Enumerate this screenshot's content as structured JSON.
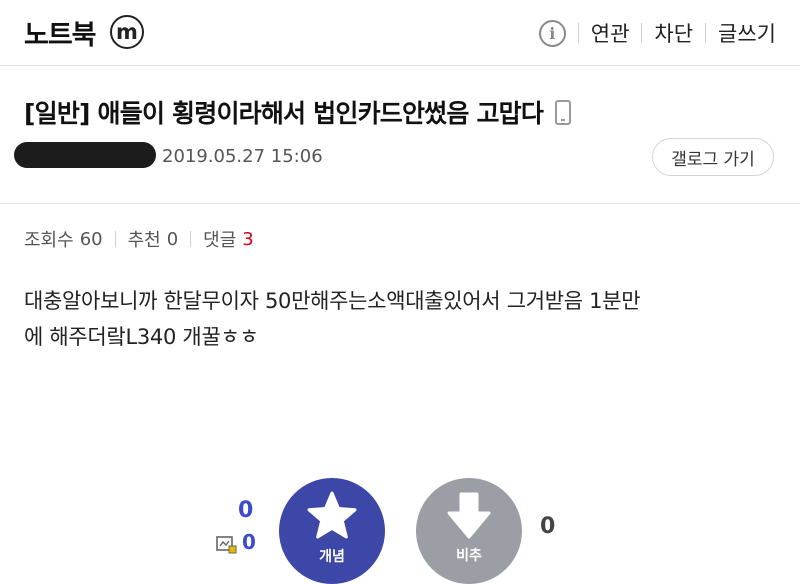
{
  "header": {
    "gallery_name": "노트북",
    "badge": "ⓜ",
    "actions": [
      "연관",
      "차단",
      "글쓰기"
    ]
  },
  "post": {
    "title": "[일반] 애들이 횡령이라해서 법인카드안썼음 고맙다",
    "date": "2019.05.27 15:06",
    "gallog_label": "갤로그 가기",
    "stats": {
      "views_label": "조회수",
      "views": "60",
      "recommend_label": "추천",
      "recommend": "0",
      "comments_label": "댓글",
      "comments": "3"
    },
    "body_lines": [
      "대충알아보니까 한달무이자 50만해주는소액대출있어서 그거받음 1분만",
      "에 해주더랔L340 개꿀ㅎㅎ"
    ]
  },
  "votes": {
    "up_count": "0",
    "fixed_count": "0",
    "up_label": "개념",
    "down_label": "비추",
    "down_count": "0"
  },
  "colors": {
    "up_button": "#3d47a8",
    "down_button": "#9c9ea6",
    "comment_count": "#d0021b",
    "vote_count": "#3b4bd0"
  }
}
